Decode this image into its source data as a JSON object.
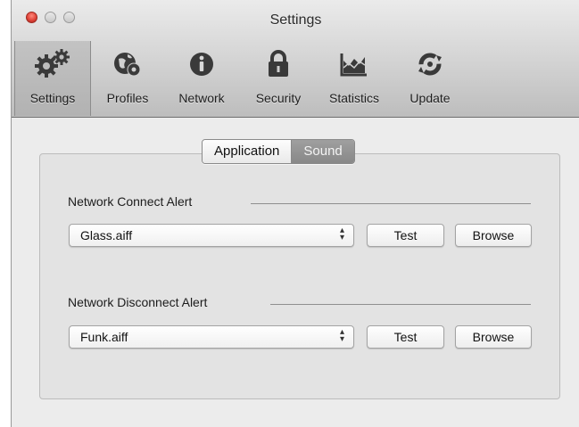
{
  "window": {
    "title": "Settings"
  },
  "toolbar": {
    "items": [
      {
        "label": "Settings",
        "icon": "gears-icon",
        "selected": true
      },
      {
        "label": "Profiles",
        "icon": "globe-gear-icon",
        "selected": false
      },
      {
        "label": "Network",
        "icon": "info-icon",
        "selected": false
      },
      {
        "label": "Security",
        "icon": "lock-icon",
        "selected": false
      },
      {
        "label": "Statistics",
        "icon": "area-chart-icon",
        "selected": false
      },
      {
        "label": "Update",
        "icon": "refresh-icon",
        "selected": false
      }
    ]
  },
  "tabs": [
    {
      "label": "Application",
      "active": true
    },
    {
      "label": "Sound",
      "active": false
    }
  ],
  "sound": {
    "connect": {
      "label": "Network Connect Alert",
      "value": "Glass.aiff",
      "test_label": "Test",
      "browse_label": "Browse"
    },
    "disconnect": {
      "label": "Network Disconnect Alert",
      "value": "Funk.aiff",
      "test_label": "Test",
      "browse_label": "Browse"
    }
  },
  "colors": {
    "close_button": "#e0443a",
    "selected_toolbar": "#b8b8b8",
    "inactive_tab": "#8f8f8f"
  }
}
